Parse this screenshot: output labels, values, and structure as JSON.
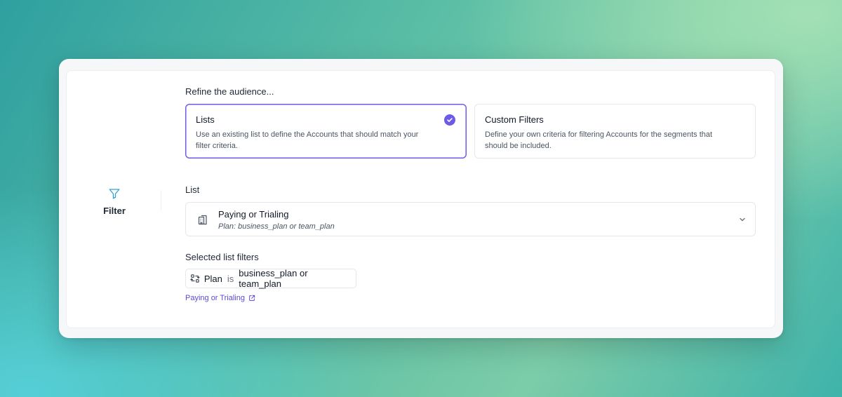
{
  "step": {
    "icon": "funnel-icon",
    "label": "Filter"
  },
  "refine": {
    "heading": "Refine the audience...",
    "options": [
      {
        "title": "Lists",
        "description": "Use an existing list to define the Accounts that should match your filter criteria.",
        "selected": true
      },
      {
        "title": "Custom Filters",
        "description": "Define your own criteria for filtering Accounts for the segments that should be included.",
        "selected": false
      }
    ]
  },
  "list": {
    "label": "List",
    "selected_title": "Paying or Trialing",
    "selected_subtitle": "Plan: business_plan or team_plan"
  },
  "selected_filters": {
    "label": "Selected list filters",
    "field": "Plan",
    "operator": "is",
    "value": "business_plan or team_plan",
    "link_text": "Paying or Trialing"
  },
  "colors": {
    "accent": "#6d5ae6",
    "link": "#5b4bd6",
    "icon_teal": "#38a3c9"
  }
}
